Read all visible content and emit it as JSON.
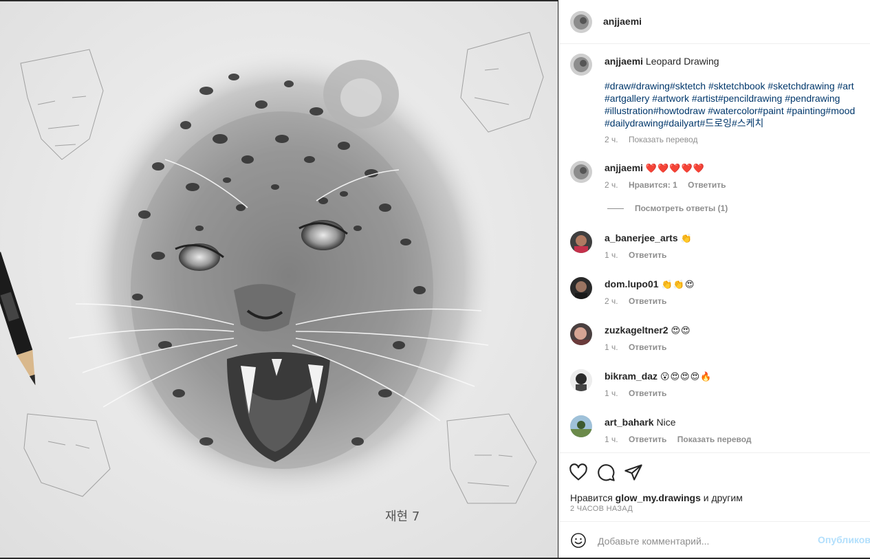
{
  "post": {
    "author": "anjjaemi",
    "caption": {
      "author": "anjjaemi",
      "text": "Leopard Drawing",
      "hashtags_lines": [
        "#draw#drawing#sktetch #sktetchbook #sketchdrawing #art",
        "#artgallery #artwork #artist#pencildrawing #pendrawing",
        "#illustration#howtodraw #watercolor#paint #painting#mood",
        "#dailydrawing#dailyart#드로잉#스케치"
      ],
      "time": "2 ч.",
      "translate": "Показать перевод"
    },
    "image_signature": "재현 7"
  },
  "comments": [
    {
      "user": "anjjaemi",
      "text": "❤️❤️❤️❤️❤️",
      "time": "2 ч.",
      "likes": "Нравится: 1",
      "reply": "Ответить",
      "view_replies": "Посмотреть ответы (1)"
    },
    {
      "user": "a_banerjee_arts",
      "text": "👏",
      "time": "1 ч.",
      "reply": "Ответить"
    },
    {
      "user": "dom.lupo01",
      "text": "👏👏😍",
      "time": "2 ч.",
      "reply": "Ответить"
    },
    {
      "user": "zuzkageltner2",
      "text": "😍😍",
      "time": "1 ч.",
      "reply": "Ответить"
    },
    {
      "user": "bikram_daz",
      "text": "😮😍😍😍🔥",
      "time": "1 ч.",
      "reply": "Ответить"
    },
    {
      "user": "art_bahark",
      "text": "Nice",
      "time": "1 ч.",
      "reply": "Ответить",
      "translate": "Показать перевод"
    }
  ],
  "actions": {
    "like_icon": "heart-icon",
    "comment_icon": "comment-icon",
    "share_icon": "paper-plane-icon",
    "likes_prefix": "Нравится",
    "likes_user": "glow_my.drawings",
    "likes_suffix": "и другим",
    "posted": "2 ЧАСОВ НАЗАД"
  },
  "add_comment": {
    "placeholder": "Добавьте комментарий...",
    "publish": "Опубликовать"
  },
  "colors": {
    "text": "#262626",
    "muted": "#8e8e8e",
    "hashtag": "#00376b",
    "publish_disabled": "#b2dffc",
    "heart": "#ed4956"
  }
}
